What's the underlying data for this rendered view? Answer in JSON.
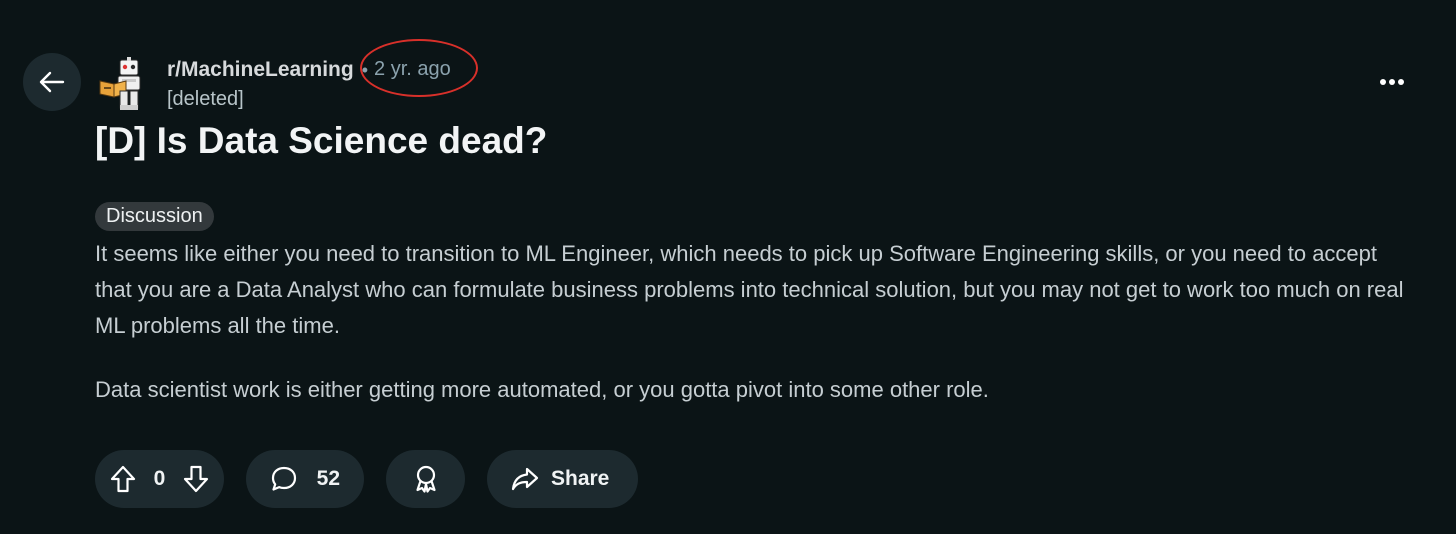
{
  "post": {
    "subreddit": "r/MachineLearning",
    "separator": "•",
    "time": "2 yr. ago",
    "author": "[deleted]",
    "title": "[D] Is Data Science dead?",
    "flair": "Discussion",
    "body": [
      "It seems like either you need to transition to ML Engineer, which needs to pick up Software Engineering skills, or you need to accept that you are a Data Analyst who can formulate business problems into technical solution, but you may not get to work too much on real ML problems all the time.",
      "Data scientist work is either getting more automated, or you gotta pivot into some other role."
    ]
  },
  "actions": {
    "vote_count": "0",
    "comment_count": "52",
    "share_label": "Share"
  },
  "icons": {
    "back": "arrow-left-icon",
    "more": "more-horizontal-icon",
    "upvote": "upvote-arrow-icon",
    "downvote": "downvote-arrow-icon",
    "comment": "comment-bubble-icon",
    "award": "award-icon",
    "share": "share-arrow-icon",
    "avatar": "subreddit-robot-avatar"
  },
  "colors": {
    "background": "#0b1416",
    "button": "#1d2a2f",
    "annotation_circle": "#d8302a"
  }
}
